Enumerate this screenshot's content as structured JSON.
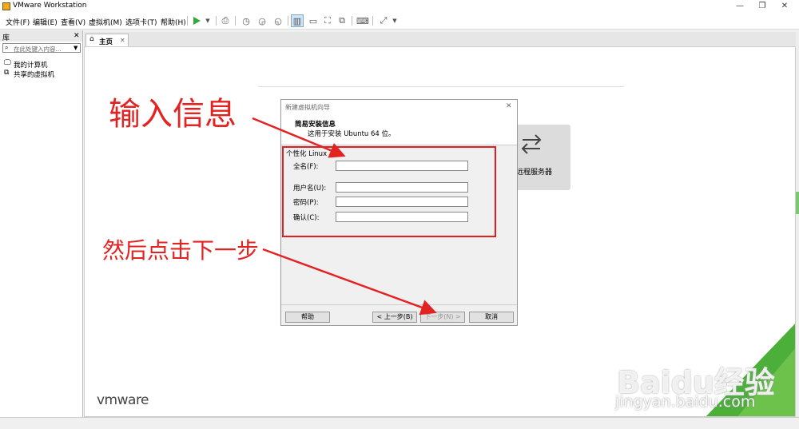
{
  "window": {
    "title": "VMware Workstation",
    "controls": [
      "—",
      "❐",
      "✕"
    ]
  },
  "menu": [
    "文件(F)",
    "编辑(E)",
    "查看(V)",
    "虚拟机(M)",
    "选项卡(T)",
    "帮助(H)"
  ],
  "library": {
    "title": "库",
    "close": "✕",
    "search_placeholder": "在此处键入内容...",
    "items": [
      "我的计算机",
      "共享的虚拟机"
    ]
  },
  "tabs": [
    {
      "label": "主页",
      "close": "✕"
    }
  ],
  "home": {
    "remote_label": "远程服务器",
    "logo": "vmware"
  },
  "dialog": {
    "title": "新建虚拟机向导",
    "close": "✕",
    "heading": "简易安装信息",
    "subheading": "这用于安装 Ubuntu 64 位。",
    "group_label": "个性化 Linux",
    "fields": [
      {
        "label": "全名(F):",
        "value": ""
      },
      {
        "label": "用户名(U):",
        "value": ""
      },
      {
        "label": "密码(P):",
        "value": ""
      },
      {
        "label": "确认(C):",
        "value": ""
      }
    ],
    "buttons": {
      "help": "帮助",
      "back": "< 上一步(B)",
      "next": "下一步(N) >",
      "cancel": "取消"
    }
  },
  "annotations": {
    "input_info": "输入信息",
    "click_next": "然后点击下一步"
  },
  "watermark": {
    "brand": "Baidu经验",
    "url": "jingyan.baidu.com"
  },
  "colors": {
    "annotation": "#e32222",
    "accent_green": "#4caf3a",
    "play": "#3aa63a"
  }
}
